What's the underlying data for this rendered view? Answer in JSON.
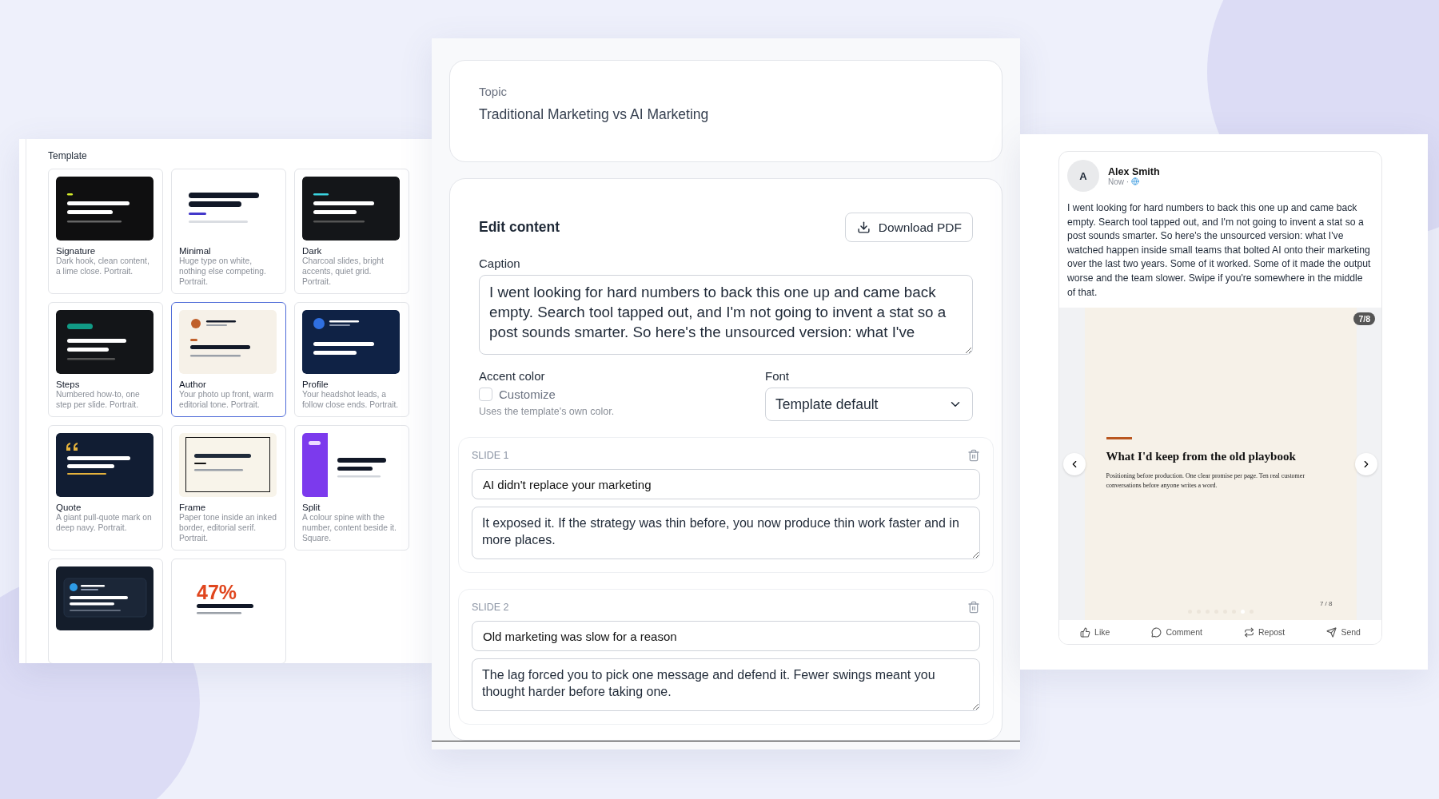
{
  "templates": {
    "label": "Template",
    "items": [
      {
        "kind": "signature",
        "name": "Signature",
        "description": "Dark hook, clean content, a lime close. Portrait.",
        "selected": false
      },
      {
        "kind": "minimal",
        "name": "Minimal",
        "description": "Huge type on white, nothing else competing. Portrait.",
        "selected": false
      },
      {
        "kind": "dark",
        "name": "Dark",
        "description": "Charcoal slides, bright accents, quiet grid. Portrait.",
        "selected": false
      },
      {
        "kind": "steps",
        "name": "Steps",
        "description": "Numbered how-to, one step per slide. Portrait.",
        "selected": false
      },
      {
        "kind": "author",
        "name": "Author",
        "description": "Your photo up front, warm editorial tone. Portrait.",
        "selected": true
      },
      {
        "kind": "profile",
        "name": "Profile",
        "description": "Your headshot leads, a follow close ends. Portrait.",
        "selected": false
      },
      {
        "kind": "quote",
        "name": "Quote",
        "description": "A giant pull-quote mark on deep navy. Portrait.",
        "selected": false
      },
      {
        "kind": "frame",
        "name": "Frame",
        "description": "Paper tone inside an inked border, editorial serif. Portrait.",
        "selected": false
      },
      {
        "kind": "split",
        "name": "Split",
        "description": "A colour spine with the number, content beside it. Square.",
        "selected": false
      },
      {
        "kind": "card",
        "selected": false
      },
      {
        "kind": "stat",
        "stat": "47%",
        "selected": false
      }
    ]
  },
  "topic": {
    "label": "Topic",
    "value": "Traditional Marketing vs AI Marketing"
  },
  "editor": {
    "title": "Edit content",
    "download_button": "Download PDF",
    "caption": {
      "label": "Caption",
      "value": "I went looking for hard numbers to back this one up and came back empty. Search tool tapped out, and I'm not going to invent a stat so a post sounds smarter. So here's the unsourced version: what I've"
    },
    "accent": {
      "label": "Accent color",
      "checkbox": "Customize",
      "checked": false,
      "hint": "Uses the template's own color."
    },
    "font": {
      "label": "Font",
      "value": "Template default"
    },
    "slides": [
      {
        "label": "SLIDE 1",
        "title": "AI didn't replace your marketing",
        "body": "It exposed it. If the strategy was thin before, you now produce thin work faster and in more places."
      },
      {
        "label": "SLIDE 2",
        "title": "Old marketing was slow for a reason",
        "body": "The lag forced you to pick one message and defend it. Fewer swings meant you thought harder before taking one."
      }
    ]
  },
  "preview": {
    "avatar": "A",
    "author": "Alex Smith",
    "time": "Now ·",
    "text": "I went looking for hard numbers to back this one up and came back empty. Search tool tapped out, and I'm not going to invent a stat so a post sounds smarter. So here's the unsourced version: what I've watched happen inside small teams that bolted AI onto their marketing over the last two years. Some of it worked. Some of it made the output worse and the team slower. Swipe if you're somewhere in the middle of that.",
    "counter": "7/8",
    "slide": {
      "heading": "What I'd keep from the old playbook",
      "body": "Positioning before production. One clear promise per page. Ten real customer conversations before anyone writes a word.",
      "page": "7 / 8",
      "dots": [
        {
          "selected": false
        },
        {
          "selected": false
        },
        {
          "selected": false
        },
        {
          "selected": false
        },
        {
          "selected": false
        },
        {
          "selected": false
        },
        {
          "selected": true
        },
        {
          "selected": false
        }
      ]
    },
    "actions": [
      {
        "kind": "like",
        "label": "Like"
      },
      {
        "kind": "comment",
        "label": "Comment"
      },
      {
        "kind": "repost",
        "label": "Repost"
      },
      {
        "kind": "send",
        "label": "Send"
      }
    ]
  }
}
